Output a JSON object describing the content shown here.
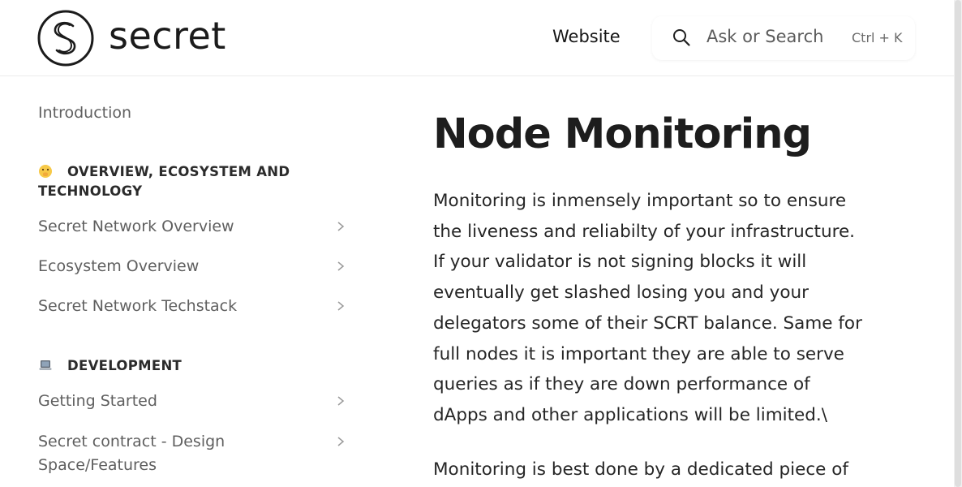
{
  "header": {
    "logo_text": "secret",
    "nav_link": "Website",
    "search": {
      "placeholder": "Ask or Search",
      "shortcut": "Ctrl + K"
    }
  },
  "sidebar": {
    "intro": "Introduction",
    "sections": [
      {
        "emoji": "face-with-hand-over-mouth-emoji",
        "title": "OVERVIEW, ECOSYSTEM AND TECHNOLOGY",
        "items": [
          "Secret Network Overview",
          "Ecosystem Overview",
          "Secret Network Techstack"
        ]
      },
      {
        "emoji": "laptop-emoji",
        "title": "DEVELOPMENT",
        "items": [
          "Getting Started",
          "Secret contract - Design Space/Features"
        ]
      }
    ]
  },
  "main": {
    "title": "Node Monitoring",
    "paragraphs": [
      "Monitoring is inmensely important so to ensure the liveness and reliabilty of your infrastructure. If your validator is not signing blocks it will eventually get slashed losing you and your delegators some of their SCRT balance. Same for full nodes it is important they are able to serve queries as if they are down performance of dApps and other applications will be limited.\\",
      "Monitoring is best done by a dedicated piece of"
    ]
  },
  "colors": {
    "text_primary": "#1d1d1d",
    "text_muted": "#5f5f5f",
    "border": "#ebebeb"
  }
}
